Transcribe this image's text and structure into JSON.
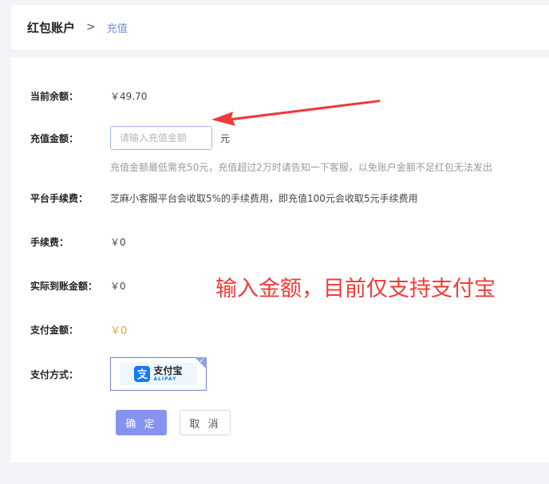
{
  "breadcrumb": {
    "root": "红包账户",
    "separator": ">",
    "current": "充值"
  },
  "form": {
    "balance": {
      "label": "当前余额：",
      "value": "￥49.70"
    },
    "amount": {
      "label": "充值金额：",
      "placeholder": "请输入充值金额",
      "value": "",
      "unit": "元",
      "hint": "充值金额最低需充50元，充值超过2万时请告知一下客服，以免账户金额不足红包无法发出"
    },
    "platform_fee": {
      "label": "平台手续费：",
      "value": "芝麻小客服平台会收取5%的手续费用，即充值100元会收取5元手续费用"
    },
    "fee": {
      "label": "手续费：",
      "value": "￥0"
    },
    "actual_amount": {
      "label": "实际到账金额：",
      "value": "￥0"
    },
    "pay_amount": {
      "label": "支付金额：",
      "value": "￥0"
    },
    "pay_method": {
      "label": "支付方式：",
      "selected": "支付宝",
      "selected_en": "ALIPAY",
      "brand_color": "#1677ff"
    }
  },
  "buttons": {
    "confirm": "确 定",
    "cancel": "取 消"
  },
  "annotation": {
    "text": "输入金额，目前仅支持支付宝",
    "color": "#ef3b3b"
  }
}
